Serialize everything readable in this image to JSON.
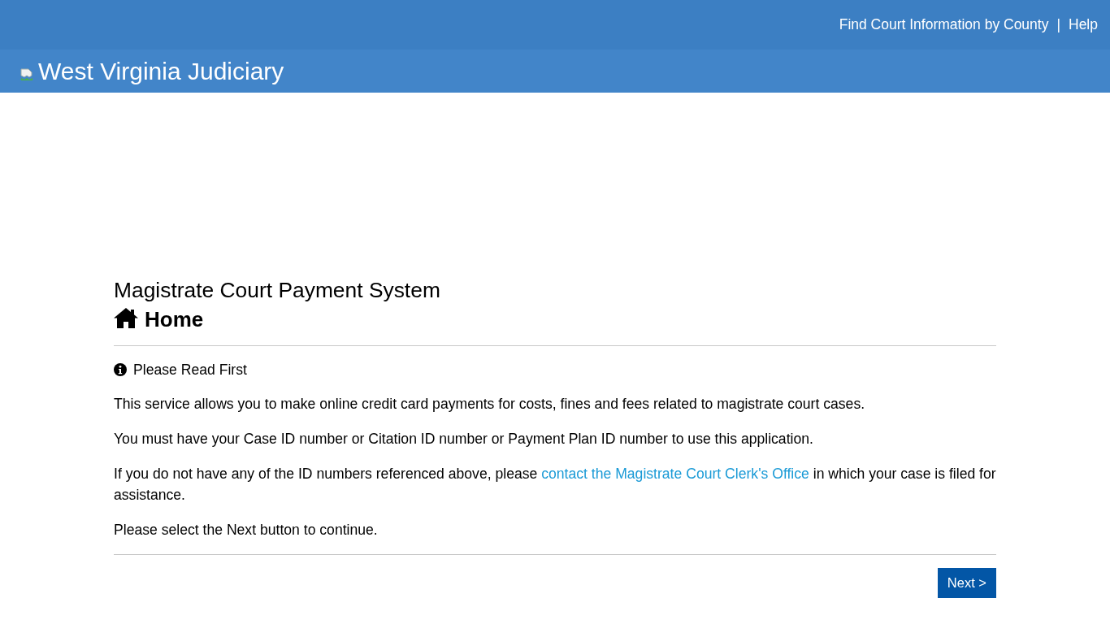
{
  "top_bar": {
    "links": [
      {
        "kind": "link",
        "text": "Find Court Information by County"
      },
      {
        "kind": "separator",
        "text": "|"
      },
      {
        "kind": "link",
        "text": "Help"
      }
    ]
  },
  "brand_bar": {
    "title": "West Virginia Judiciary"
  },
  "page": {
    "app_title": "Magistrate Court Payment System",
    "heading": "Home",
    "notice": {
      "heading": "Please Read First",
      "paragraphs": [
        {
          "kind": "plain",
          "text": "This service allows you to make online credit card payments for costs, fines and fees related to magistrate court cases."
        },
        {
          "kind": "plain",
          "text": "You must have your Case ID number or Citation ID number or Payment Plan ID number to use this application."
        },
        {
          "kind": "with_link",
          "text_before": "If you do not have any of the ID numbers referenced above, please",
          "link": "contact the Magistrate Court Clerk's Office",
          "text_after": "in which your case is filed for assistance."
        },
        {
          "kind": "plain",
          "text": "Please select the Next button to continue."
        }
      ]
    },
    "buttons": [
      {
        "label": "Next >"
      }
    ]
  }
}
